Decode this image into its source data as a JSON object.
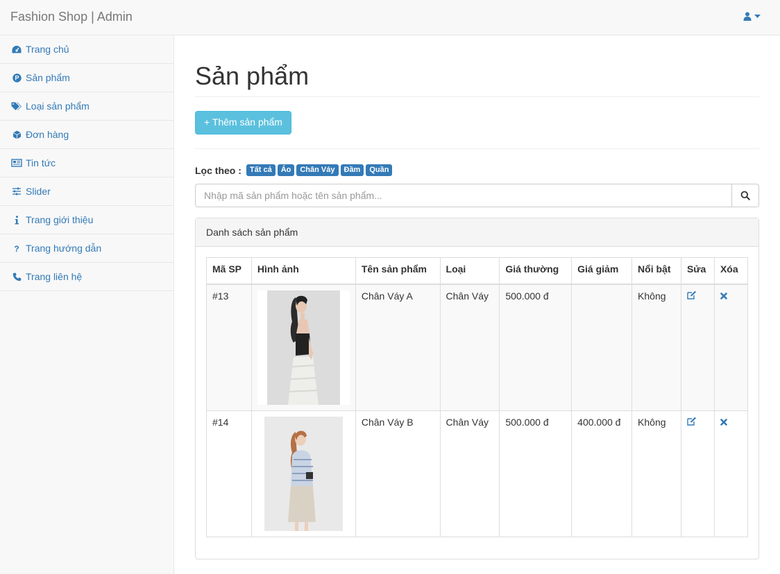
{
  "navbar": {
    "brand": "Fashion Shop | Admin",
    "user_icon": "user-icon"
  },
  "sidebar": {
    "items": [
      {
        "label": "Trang chủ",
        "icon": "dashboard-icon"
      },
      {
        "label": "Sản phẩm",
        "icon": "product-icon"
      },
      {
        "label": "Loại sản phẩm",
        "icon": "tags-icon"
      },
      {
        "label": "Đơn hàng",
        "icon": "cube-icon"
      },
      {
        "label": "Tin tức",
        "icon": "newspaper-icon"
      },
      {
        "label": "Slider",
        "icon": "sliders-icon"
      },
      {
        "label": "Trang giới thiệu",
        "icon": "info-icon"
      },
      {
        "label": "Trang hướng dẫn",
        "icon": "question-icon"
      },
      {
        "label": "Trang liên hệ",
        "icon": "phone-icon"
      }
    ]
  },
  "main": {
    "title": "Sản phẩm",
    "add_button": "+ Thêm sản phẩm",
    "filter_label": "Lọc theo :",
    "filters": [
      "Tất cả",
      "Áo",
      "Chân Váy",
      "Đầm",
      "Quần"
    ],
    "search_placeholder": "Nhập mã sản phẩm hoặc tên sản phẩm...",
    "panel_title": "Danh sách sản phẩm",
    "columns": [
      "Mã SP",
      "Hình ảnh",
      "Tên sản phẩm",
      "Loại",
      "Giá thường",
      "Giá giảm",
      "Nổi bật",
      "Sửa",
      "Xóa"
    ],
    "rows": [
      {
        "id": "#13",
        "name": "Chân Váy A",
        "type": "Chân Váy",
        "price": "500.000 đ",
        "sale": "",
        "featured": "Không"
      },
      {
        "id": "#14",
        "name": "Chân Váy B",
        "type": "Chân Váy",
        "price": "500.000 đ",
        "sale": "400.000 đ",
        "featured": "Không"
      }
    ]
  },
  "colors": {
    "link": "#337ab7",
    "info_button": "#5bc0de"
  }
}
